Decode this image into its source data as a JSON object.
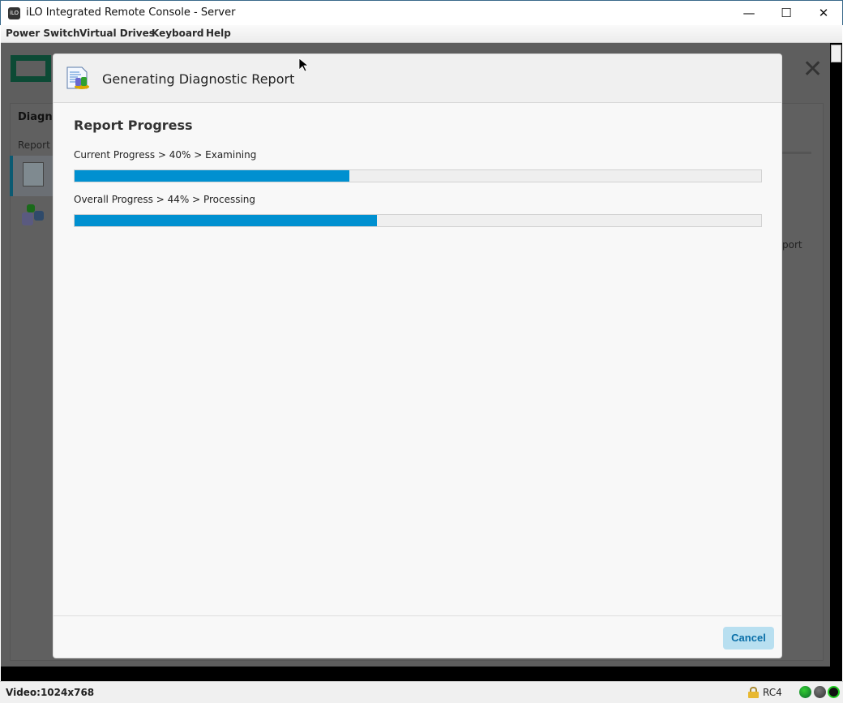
{
  "window": {
    "title": "iLO Integrated Remote Console - Server",
    "app_icon": "iLO"
  },
  "menu": [
    "Power Switch",
    "Virtual Drives",
    "Keyboard",
    "Help"
  ],
  "background": {
    "panel_title": "Diagno",
    "panel_sub": "Report",
    "right_text": "port"
  },
  "dialog": {
    "title": "Generating Diagnostic Report",
    "section": "Report Progress",
    "current": {
      "label": "Current Progress > 40% > Examining",
      "percent": 40
    },
    "overall": {
      "label": "Overall Progress > 44% > Processing",
      "percent": 44
    },
    "cancel": "Cancel"
  },
  "status": {
    "video": "Video:1024x768",
    "cipher": "RC4"
  },
  "colors": {
    "progress": "#0090d0",
    "cancel_bg": "#b8dff0",
    "cancel_text": "#0a6fa8",
    "led_green": "#0a8a2a",
    "power": "#22cc22"
  }
}
